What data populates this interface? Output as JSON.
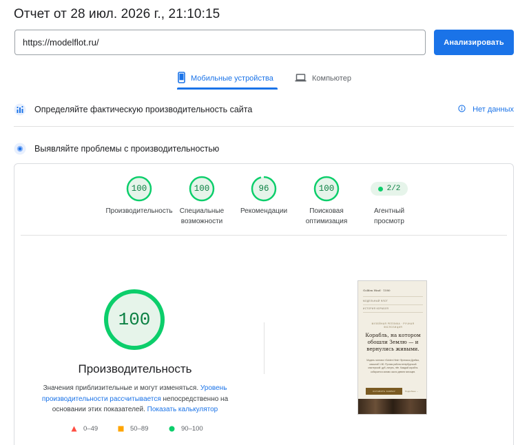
{
  "report": {
    "title": "Отчет от 28 июл. 2026 г., 21:10:15"
  },
  "search": {
    "url": "https://modelflot.ru/",
    "button_label": "Анализировать"
  },
  "tabs": [
    {
      "label": "Мобильные устройства",
      "icon": "smartphone-icon",
      "active": true
    },
    {
      "label": "Компьютер",
      "icon": "laptop-icon",
      "active": false
    }
  ],
  "field_section": {
    "title": "Определяйте фактическую производительность сайта",
    "no_data_label": "Нет данных",
    "icon": "field-data-icon"
  },
  "lab_section": {
    "title": "Выявляйте проблемы с производительностью",
    "icon": "lab-data-icon"
  },
  "categories": [
    {
      "score": "100",
      "label_line1": "Производительность",
      "label_line2": ""
    },
    {
      "score": "100",
      "label_line1": "Специальные",
      "label_line2": "возможности"
    },
    {
      "score": "96",
      "label_line1": "Рекомендации",
      "label_line2": ""
    },
    {
      "score": "100",
      "label_line1": "Поисковая",
      "label_line2": "оптимизация"
    }
  ],
  "agent_badge": {
    "value": "2/2",
    "label_line1": "Агентный",
    "label_line2": "просмотр"
  },
  "performance": {
    "score": "100",
    "title": "Производительность",
    "desc_part1": "Значения приблизительные и могут изменяться. ",
    "desc_link1": "Уровень производительности рассчитывается",
    "desc_part2": " непосредственно на основании этих показателей. ",
    "desc_link2": "Показать калькулятор"
  },
  "legend": [
    {
      "range": "0–49",
      "color": "#ff4e42",
      "shape": "triangle"
    },
    {
      "range": "50–89",
      "color": "#ffa400",
      "shape": "square"
    },
    {
      "range": "90–100",
      "color": "#0cce6b",
      "shape": "circle"
    }
  ],
  "screenshot_preview": {
    "brand": "Golden Hind · 1580",
    "nav1": "МОДЕЛЬНЫЙ   ФЛОТ",
    "nav2": "ИСТОРИЯ КОРАБЛЯ",
    "kicker": "МУЗЕЙНАЯ РЕПЛИКА · РУЧНАЯ\nЭКСПОЗИЦИЯ",
    "headline": "Корабль, на котором\nобошли Землю — и\nвернулись живыми.",
    "body": "Модель галеона «Golden Hind» Фрэнсиса Дрейка, масштаб 1:50. Ручная работа петербургской мастерской: дуб, латунь, лён. Каждый корабль собирается заново около девяти месяцев.",
    "cta": "ОСТАВИТЬ ЗАЯВКУ",
    "link": "Подробнее →"
  },
  "colors": {
    "accent": "#1a73e8",
    "pass": "#0cce6b",
    "pass_text": "#0b8043",
    "pass_bg": "#e6f4ea"
  }
}
